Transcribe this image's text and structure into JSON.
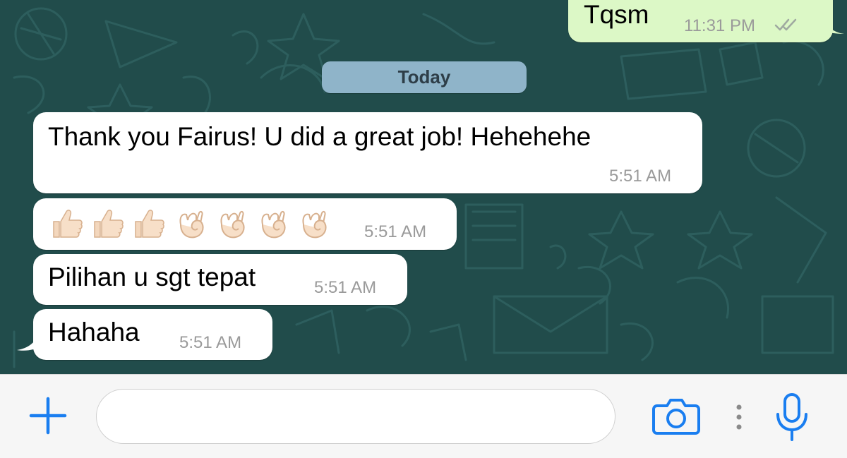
{
  "theme": {
    "outgoing_bubble": "#dcf8c6",
    "incoming_bubble": "#ffffff",
    "accent": "#1a7ef0",
    "wallpaper": "#214c4b"
  },
  "date_separator": "Today",
  "outgoing": {
    "text": "Tqsm",
    "time": "11:31 PM",
    "status_icon": "double-check-icon"
  },
  "messages": [
    {
      "text": "Thank you Fairus! U did a great job! Hehehehe",
      "time": "5:51 AM"
    },
    {
      "emoji": [
        "thumbs-up",
        "thumbs-up",
        "thumbs-up",
        "ok-hand",
        "ok-hand",
        "ok-hand",
        "ok-hand"
      ],
      "time": "5:51 AM"
    },
    {
      "text": "Pilihan u sgt tepat",
      "time": "5:51 AM"
    },
    {
      "text": "Hahaha",
      "time": "5:51 AM"
    }
  ],
  "input_bar": {
    "placeholder": "",
    "value": "",
    "icons": [
      "plus-icon",
      "camera-icon",
      "more-dots-icon",
      "microphone-icon"
    ]
  }
}
